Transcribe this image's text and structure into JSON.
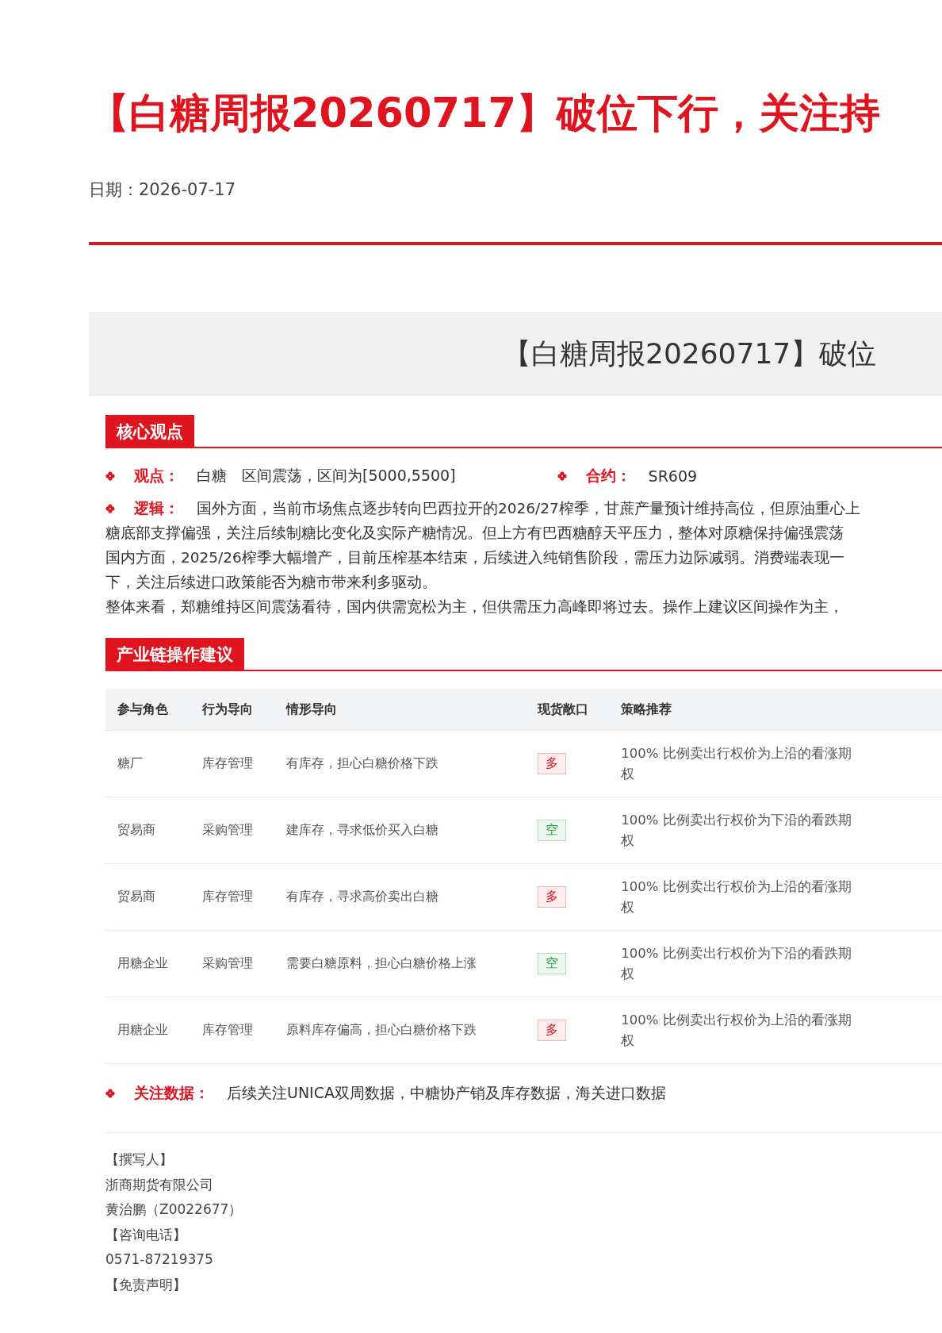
{
  "title": "【白糖周报20260717】破位下行，关注持",
  "date": {
    "label": "日期：",
    "value": "2026-07-17"
  },
  "banner": {
    "title": "【白糖周报20260717】破位"
  },
  "sections": [
    {
      "heading": "核心观点"
    },
    {
      "heading": "产业链操作建议"
    }
  ],
  "view": {
    "label": "观点：",
    "value": "白糖　区间震荡，区间为[5000,5500]"
  },
  "contract": {
    "label": "合约：",
    "value": "SR609"
  },
  "logic": {
    "label": "逻辑：",
    "lines": [
      "国外方面，当前市场焦点逐步转向巴西拉开的2026/27榨季，甘蔗产量预计维持高位，但原油重心上",
      "糖底部支撑偏强，关注后续制糖比变化及实际产糖情况。但上方有巴西糖醇天平压力，整体对原糖保持偏强震荡",
      "国内方面，2025/26榨季大幅增产，目前压榨基本结束，后续进入纯销售阶段，需压力边际减弱。消费端表现一",
      "下，关注后续进口政策能否为糖市带来利多驱动。",
      "整体来看，郑糖维持区间震荡看待，国内供需宽松为主，但供需压力高峰即将过去。操作上建议区间操作为主，"
    ]
  },
  "table": {
    "columns": [
      "参与角色",
      "行为导向",
      "情形导向",
      "现货敞口",
      "策略推荐"
    ],
    "rows": [
      {
        "role": "糖厂",
        "behavior": "库存管理",
        "situation": "有库存，担心白糖价格下跌",
        "exposure": {
          "text": "多",
          "kind": "long"
        },
        "strategy": [
          "100% 比例卖出行权价为上沿的看涨期",
          "权"
        ]
      },
      {
        "role": "贸易商",
        "behavior": "采购管理",
        "situation": "建库存，寻求低价买入白糖",
        "exposure": {
          "text": "空",
          "kind": "short"
        },
        "strategy": [
          "100% 比例卖出行权价为下沿的看跌期",
          "权"
        ]
      },
      {
        "role": "贸易商",
        "behavior": "库存管理",
        "situation": "有库存，寻求高价卖出白糖",
        "exposure": {
          "text": "多",
          "kind": "long"
        },
        "strategy": [
          "100% 比例卖出行权价为上沿的看涨期",
          "权"
        ]
      },
      {
        "role": "用糖企业",
        "behavior": "采购管理",
        "situation": "需要白糖原料，担心白糖价格上涨",
        "exposure": {
          "text": "空",
          "kind": "short"
        },
        "strategy": [
          "100% 比例卖出行权价为下沿的看跌期",
          "权"
        ]
      },
      {
        "role": "用糖企业",
        "behavior": "库存管理",
        "situation": "原料库存偏高，担心白糖价格下跌",
        "exposure": {
          "text": "多",
          "kind": "long"
        },
        "strategy": [
          "100% 比例卖出行权价为上沿的看涨期",
          "权"
        ]
      }
    ]
  },
  "focus": {
    "label": "关注数据：",
    "value": "后续关注UNICA双周数据，中糖协产销及库存数据，海关进口数据"
  },
  "footer": [
    "【撰写人】",
    "浙商期货有限公司",
    "黄治鹏（Z0022677）",
    "【咨询电话】",
    "0571-87219375",
    "【免责声明】"
  ]
}
